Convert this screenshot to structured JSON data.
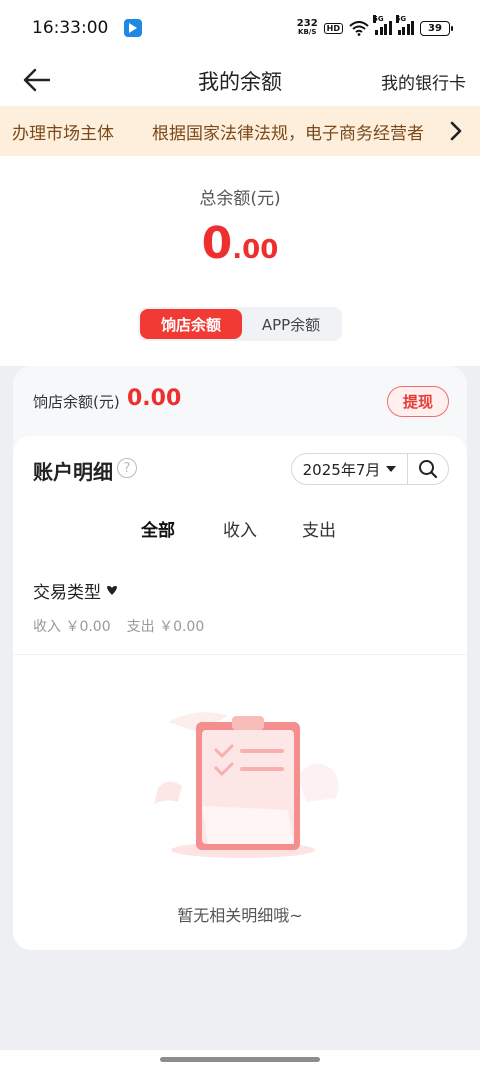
{
  "status_bar": {
    "time": "16:33:00",
    "net_speed_value": "232",
    "net_speed_unit": "KB/S",
    "hd_label": "HD",
    "signal1_tag": "5G",
    "signal2_tag": "5G",
    "battery": "39"
  },
  "nav": {
    "title": "我的余额",
    "right_link": "我的银行卡"
  },
  "notice": {
    "text_a": "办理市场主体",
    "text_b": "根据国家法律法规，电子商务经营者"
  },
  "balance": {
    "label": "总余额(元)",
    "amount_int": "0",
    "amount_dec": ".00",
    "tabs": [
      {
        "label": "饷店余额",
        "active": true
      },
      {
        "label": "APP余额",
        "active": false
      }
    ]
  },
  "sub_balance": {
    "label": "饷店余额(元)",
    "amount": "0.00",
    "withdraw_label": "提现"
  },
  "detail": {
    "title": "账户明细",
    "help": "?",
    "date": "2025年7月",
    "tabs": [
      "全部",
      "收入",
      "支出"
    ],
    "type_filter": "交易类型",
    "income_summary": "收入 ￥0.00",
    "expense_summary": "支出 ￥0.00",
    "empty_text": "暂无相关明细哦~"
  },
  "colors": {
    "accent": "#f13a34",
    "notice_bg": "#fdefdc",
    "page_bg": "#eeeff3"
  }
}
